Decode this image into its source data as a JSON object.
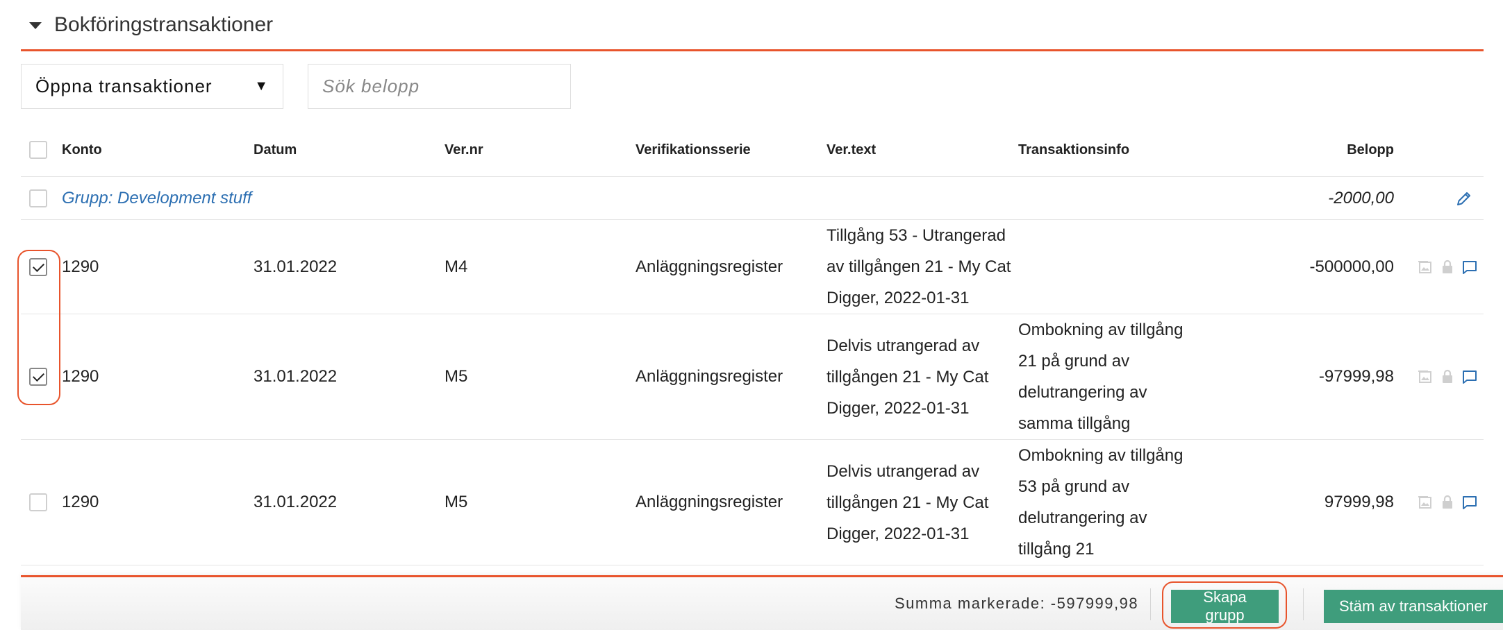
{
  "section": {
    "title": "Bokföringstransaktioner"
  },
  "filters": {
    "status_value": "Öppna transaktioner",
    "search_placeholder": "Sök belopp"
  },
  "columns": {
    "konto": "Konto",
    "datum": "Datum",
    "vernr": "Ver.nr",
    "serie": "Verifikationsserie",
    "vertext": "Ver.text",
    "info": "Transaktionsinfo",
    "belopp": "Belopp"
  },
  "group": {
    "label": "Grupp: Development stuff",
    "amount": "-2000,00"
  },
  "rows": [
    {
      "checked": true,
      "konto": "1290",
      "datum": "31.01.2022",
      "vernr": "M4",
      "serie": "Anläggningsregister",
      "vertext": [
        "Tillgång 53 - Utrangerad",
        "av tillgången 21 - My Cat",
        "Digger, 2022-01-31"
      ],
      "info": [],
      "belopp": "-500000,00"
    },
    {
      "checked": true,
      "konto": "1290",
      "datum": "31.01.2022",
      "vernr": "M5",
      "serie": "Anläggningsregister",
      "vertext": [
        "Delvis utrangerad av",
        "tillgången 21 - My Cat",
        "Digger, 2022-01-31"
      ],
      "info": [
        "Ombokning av tillgång",
        "21 på grund av",
        "delutrangering av",
        "samma tillgång"
      ],
      "belopp": "-97999,98"
    },
    {
      "checked": false,
      "konto": "1290",
      "datum": "31.01.2022",
      "vernr": "M5",
      "serie": "Anläggningsregister",
      "vertext": [
        "Delvis utrangerad av",
        "tillgången 21 - My Cat",
        "Digger, 2022-01-31"
      ],
      "info": [
        "Ombokning av tillgång",
        "53 på grund av",
        "delutrangering av",
        "tillgång 21"
      ],
      "belopp": "97999,98"
    }
  ],
  "footer": {
    "sum_label": "Summa markerade: -597999,98",
    "create_group": "Skapa grupp",
    "reconcile": "Stäm av transaktioner"
  },
  "colors": {
    "accent": "#e8542c",
    "button": "#3f9d7c",
    "link": "#2c6fb2"
  },
  "icons": [
    "edit-icon",
    "image-icon",
    "lock-icon",
    "comment-icon",
    "caret-down-icon"
  ]
}
